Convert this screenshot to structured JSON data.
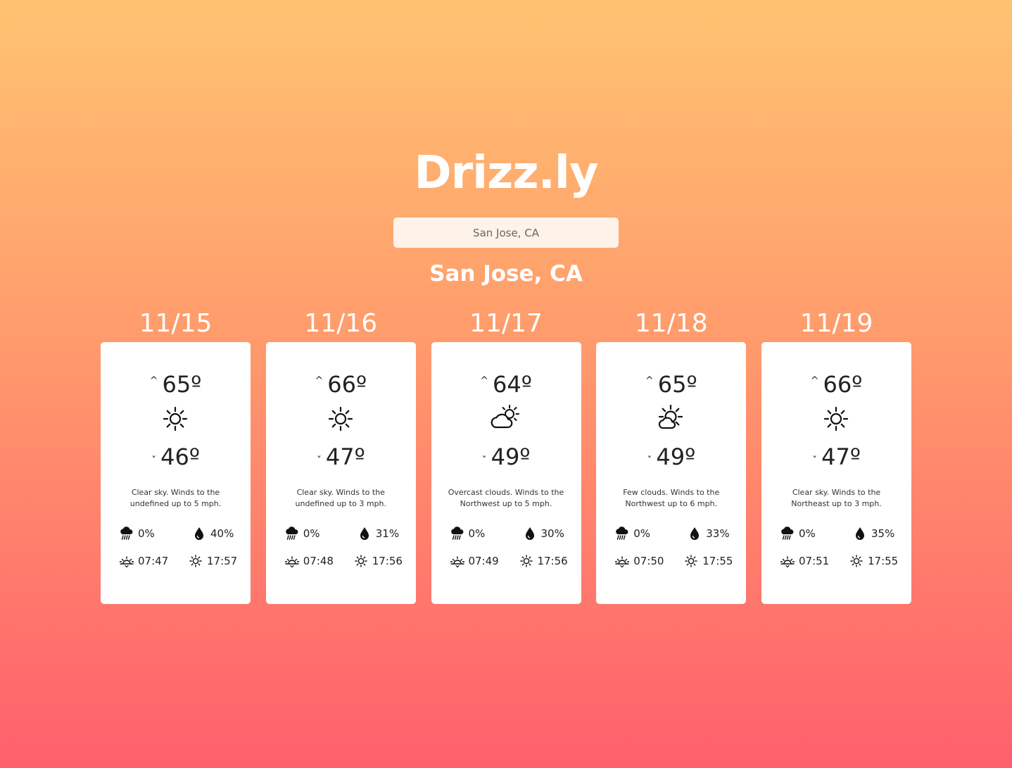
{
  "app": {
    "title": "Drizz.ly"
  },
  "search": {
    "placeholder": "San Jose, CA",
    "value": ""
  },
  "location": "San Jose, CA",
  "forecast": [
    {
      "date": "11/15",
      "high": "65º",
      "low": "46º",
      "icon": "sun-icon",
      "description": "Clear sky. Winds to the undefined up to 5 mph.",
      "precipitation": "0%",
      "humidity": "40%",
      "sunrise": "07:47",
      "sunset": "17:57"
    },
    {
      "date": "11/16",
      "high": "66º",
      "low": "47º",
      "icon": "sun-icon",
      "description": "Clear sky. Winds to the undefined up to 3 mph.",
      "precipitation": "0%",
      "humidity": "31%",
      "sunrise": "07:48",
      "sunset": "17:56"
    },
    {
      "date": "11/17",
      "high": "64º",
      "low": "49º",
      "icon": "cloudy-sun-icon",
      "description": "Overcast clouds. Winds to the Northwest up to 5 mph.",
      "precipitation": "0%",
      "humidity": "30%",
      "sunrise": "07:49",
      "sunset": "17:56"
    },
    {
      "date": "11/18",
      "high": "65º",
      "low": "49º",
      "icon": "partly-cloudy-icon",
      "description": "Few clouds. Winds to the Northwest up to 6 mph.",
      "precipitation": "0%",
      "humidity": "33%",
      "sunrise": "07:50",
      "sunset": "17:55"
    },
    {
      "date": "11/19",
      "high": "66º",
      "low": "47º",
      "icon": "sun-icon",
      "description": "Clear sky. Winds to the Northeast up to 3 mph.",
      "precipitation": "0%",
      "humidity": "35%",
      "sunrise": "07:51",
      "sunset": "17:55"
    }
  ],
  "colors": {
    "gradient_top": "#ffc371",
    "gradient_bottom": "#ff5f6d",
    "card": "#ffffff",
    "text": "#222222"
  }
}
